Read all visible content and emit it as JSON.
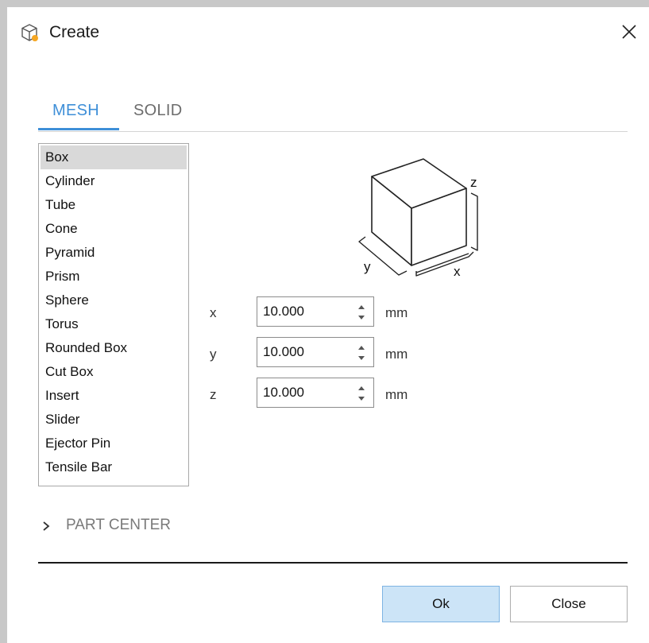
{
  "window": {
    "title": "Create",
    "icon": "cube-icon",
    "close_icon": "close-icon"
  },
  "tabs": [
    {
      "label": "MESH",
      "active": true
    },
    {
      "label": "SOLID",
      "active": false
    }
  ],
  "shapes": {
    "selected": "Box",
    "items": [
      "Box",
      "Cylinder",
      "Tube",
      "Cone",
      "Pyramid",
      "Prism",
      "Sphere",
      "Torus",
      "Rounded Box",
      "Cut Box",
      "Insert",
      "Slider",
      "Ejector Pin",
      "Tensile Bar"
    ]
  },
  "diagram": {
    "x_label": "x",
    "y_label": "y",
    "z_label": "z"
  },
  "params": [
    {
      "label": "x",
      "value": "10.000",
      "unit": "mm"
    },
    {
      "label": "y",
      "value": "10.000",
      "unit": "mm"
    },
    {
      "label": "z",
      "value": "10.000",
      "unit": "mm"
    }
  ],
  "part_center": {
    "label": "PART CENTER",
    "expanded": false
  },
  "buttons": {
    "ok": "Ok",
    "close": "Close"
  },
  "colors": {
    "accent": "#3e8fd8",
    "ok_bg": "#cce4f7",
    "selected_bg": "#d9d9d9"
  }
}
